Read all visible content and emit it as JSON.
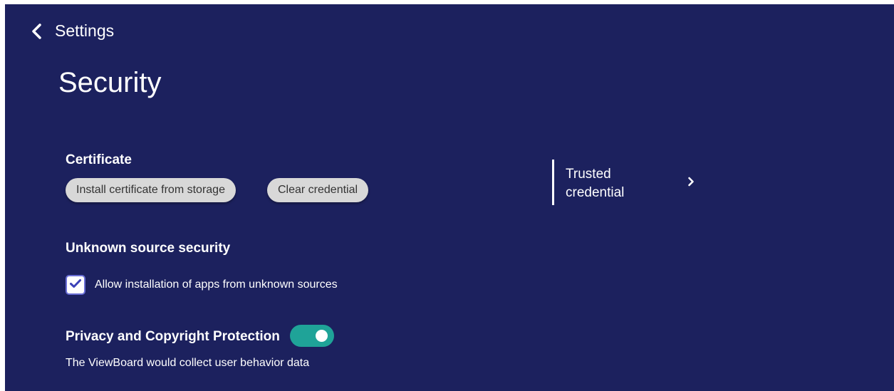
{
  "header": {
    "back_label": "Settings",
    "back_icon": "chevron-left-icon",
    "title": "Security"
  },
  "certificate": {
    "heading": "Certificate",
    "install_label": "Install certificate from storage",
    "clear_label": "Clear credential"
  },
  "trusted": {
    "label": "Trusted credential",
    "icon": "chevron-right-icon"
  },
  "unknown_source": {
    "heading": "Unknown source security",
    "checkbox_label": "Allow installation of apps from unknown sources",
    "checked": true
  },
  "privacy": {
    "heading": "Privacy and Copyright Protection",
    "toggle_on": true,
    "description": "The ViewBoard would collect user behavior data"
  },
  "colors": {
    "background": "#1c215e",
    "toggle_on": "#1fa398",
    "checkbox_border": "#6a6fd6",
    "button_bg": "#d8d8d8"
  }
}
